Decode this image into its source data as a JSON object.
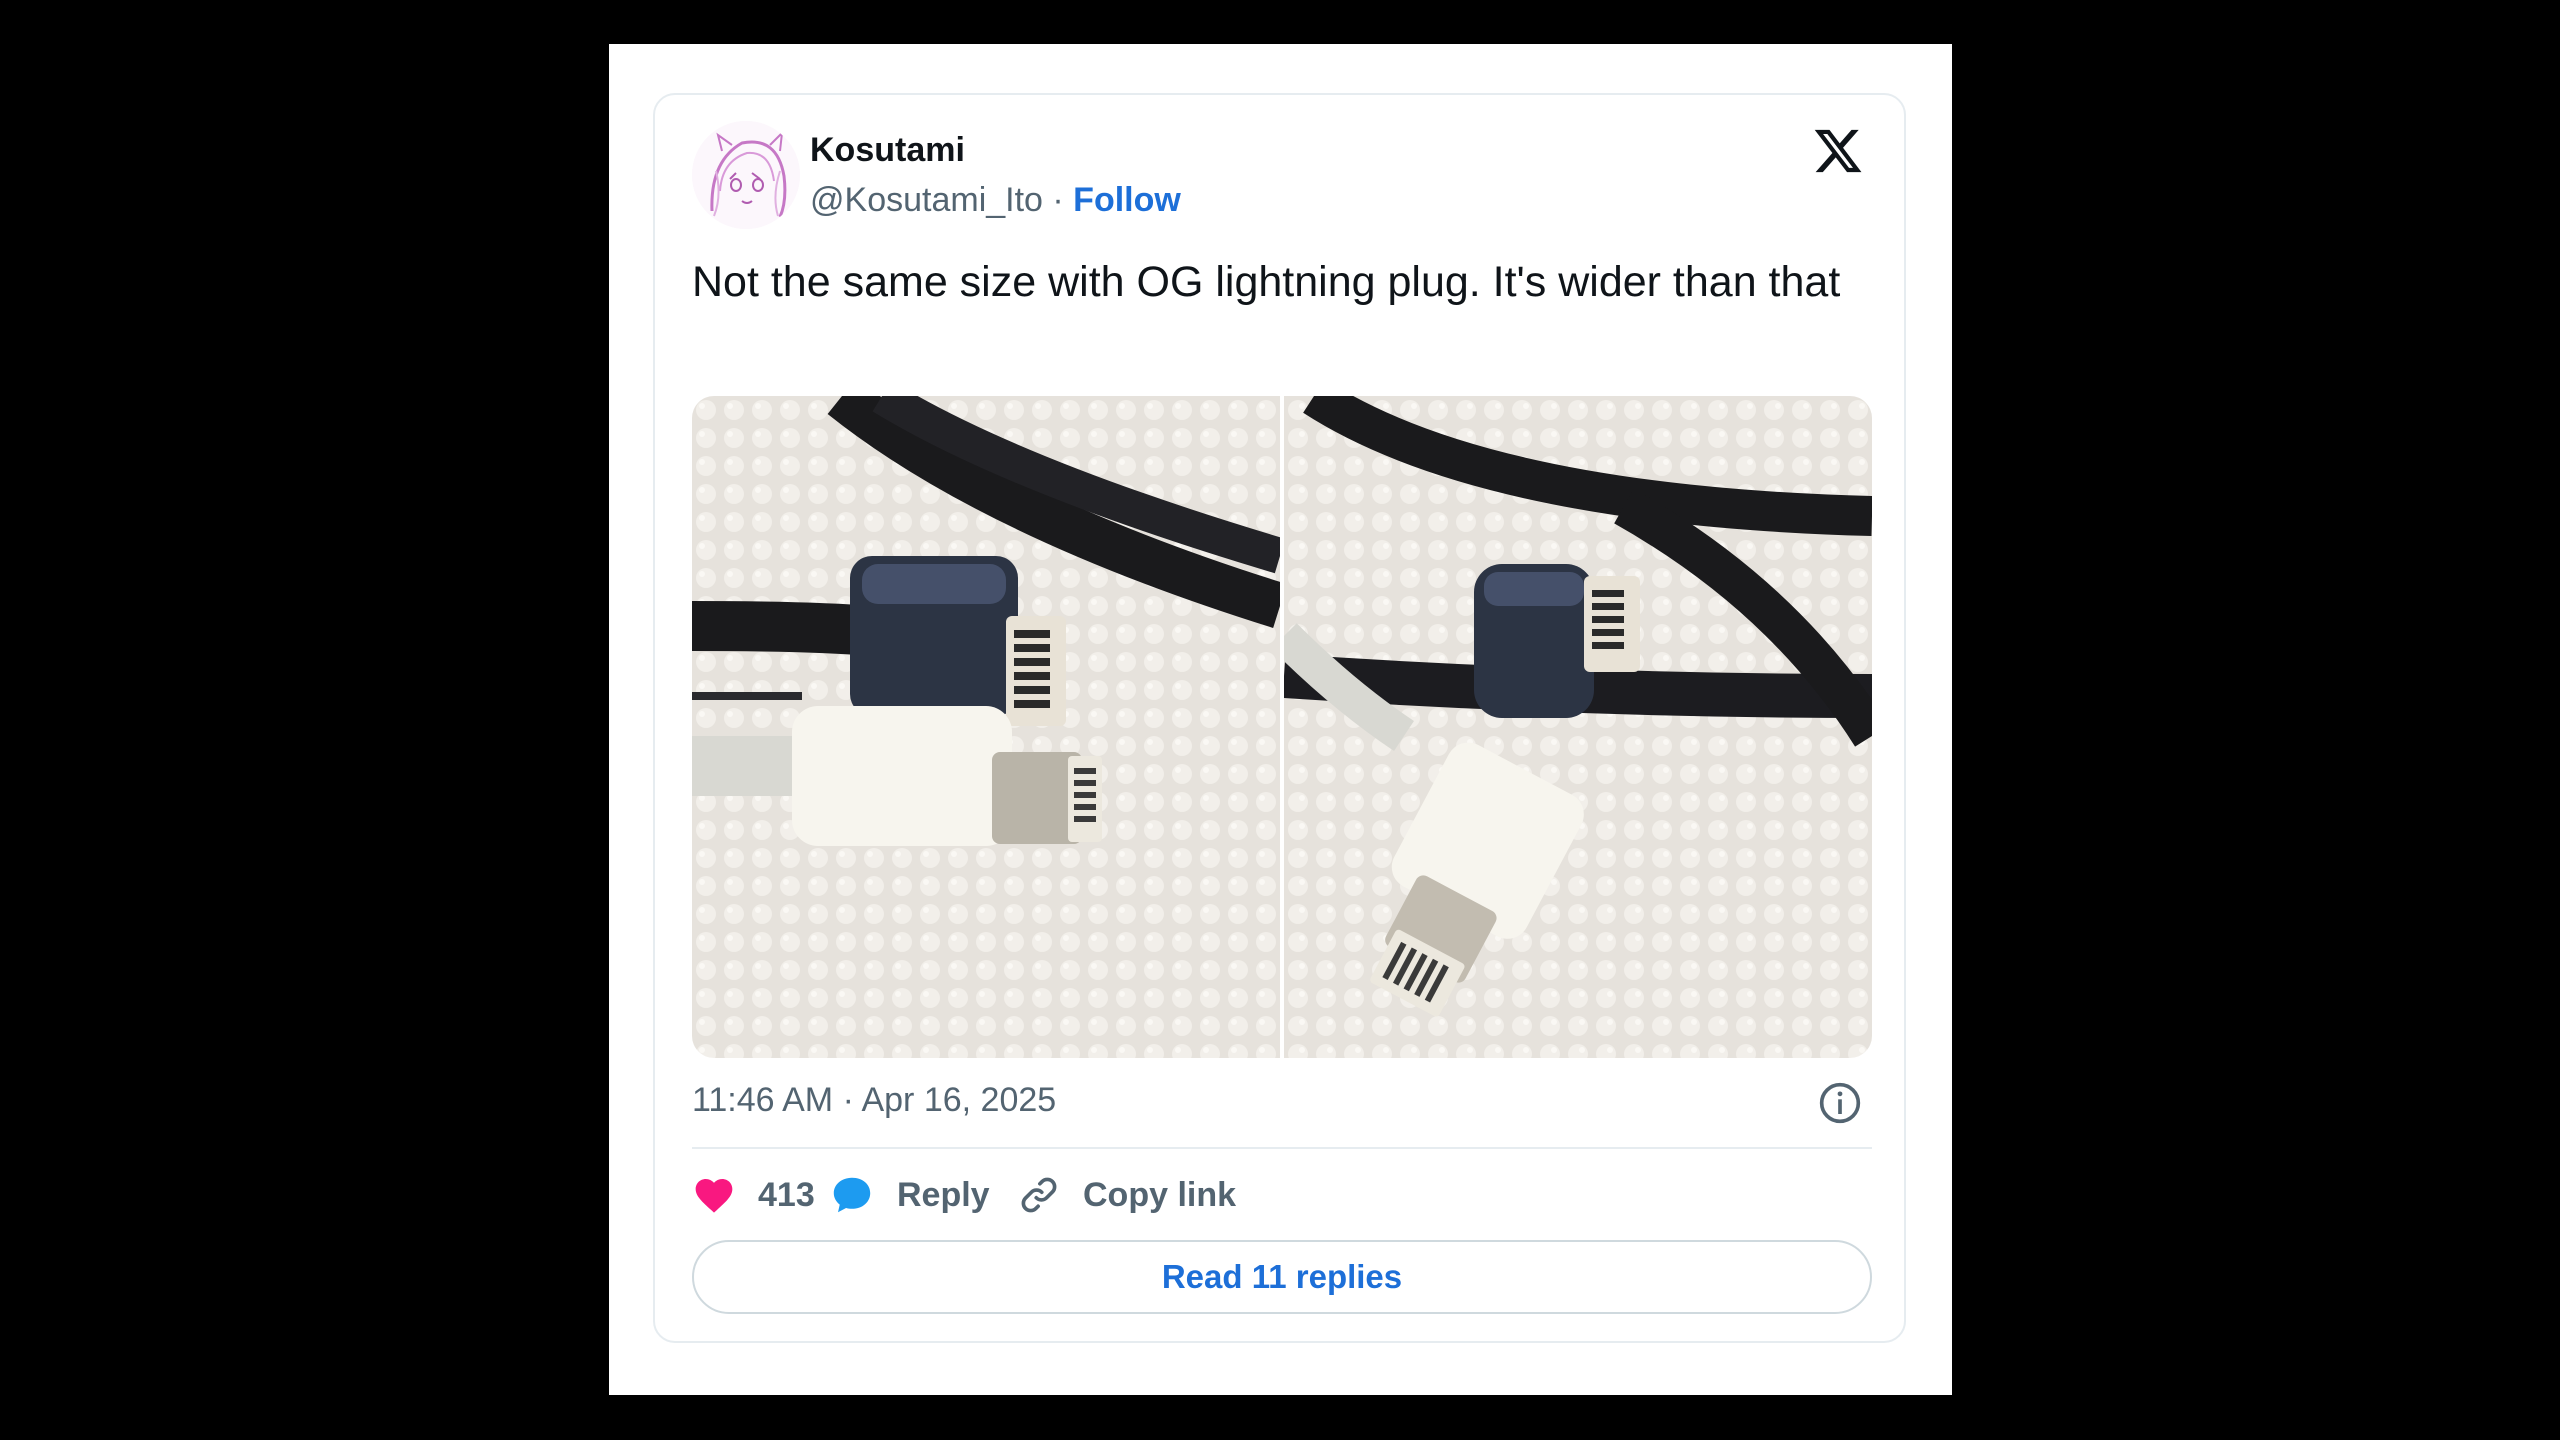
{
  "tweet": {
    "display_name": "Kosutami",
    "handle": "@Kosutami_Ito",
    "separator": " · ",
    "follow_label": "Follow",
    "text": "Not the same size with OG lightning plug. It's wider than that",
    "timestamp": "11:46 AM · Apr 16, 2025",
    "likes": "413",
    "reply_label": "Reply",
    "copy_link_label": "Copy link",
    "read_replies_label": "Read 11 replies"
  },
  "colors": {
    "like": "#f91880",
    "reply": "#1d9bf0",
    "link": "#1d6fd8",
    "muted": "#536471"
  },
  "icons": [
    "x-logo-icon",
    "info-icon",
    "heart-icon",
    "speech-bubble-icon",
    "link-icon"
  ]
}
